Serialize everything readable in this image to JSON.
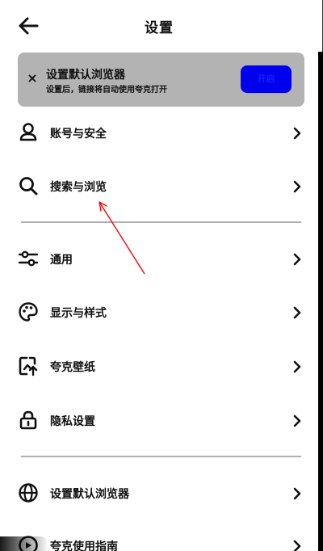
{
  "header": {
    "title": "设置",
    "back_icon": "arrow-left-icon"
  },
  "banner": {
    "close_icon": "close-icon",
    "close_glyph": "×",
    "title": "设置默认浏览器",
    "subtitle": "设置后，链接将自动使用夸克打开",
    "button_label": "开启",
    "button_color": "#0000ee",
    "background": "#b3b3b3"
  },
  "settings": {
    "items": [
      {
        "label": "账号与安全",
        "icon": "user-icon"
      },
      {
        "label": "搜索与浏览",
        "icon": "search-icon"
      },
      {
        "label": "通用",
        "icon": "sliders-icon"
      },
      {
        "label": "显示与样式",
        "icon": "palette-icon"
      },
      {
        "label": "夸克壁纸",
        "icon": "wallpaper-icon"
      },
      {
        "label": "隐私设置",
        "icon": "lock-icon"
      },
      {
        "label": "设置默认浏览器",
        "icon": "globe-icon"
      },
      {
        "label": "夸克使用指南",
        "icon": "guide-icon"
      }
    ]
  },
  "annotation": {
    "color": "#ff0000",
    "kind": "arrow pointing to search-and-browse item"
  }
}
